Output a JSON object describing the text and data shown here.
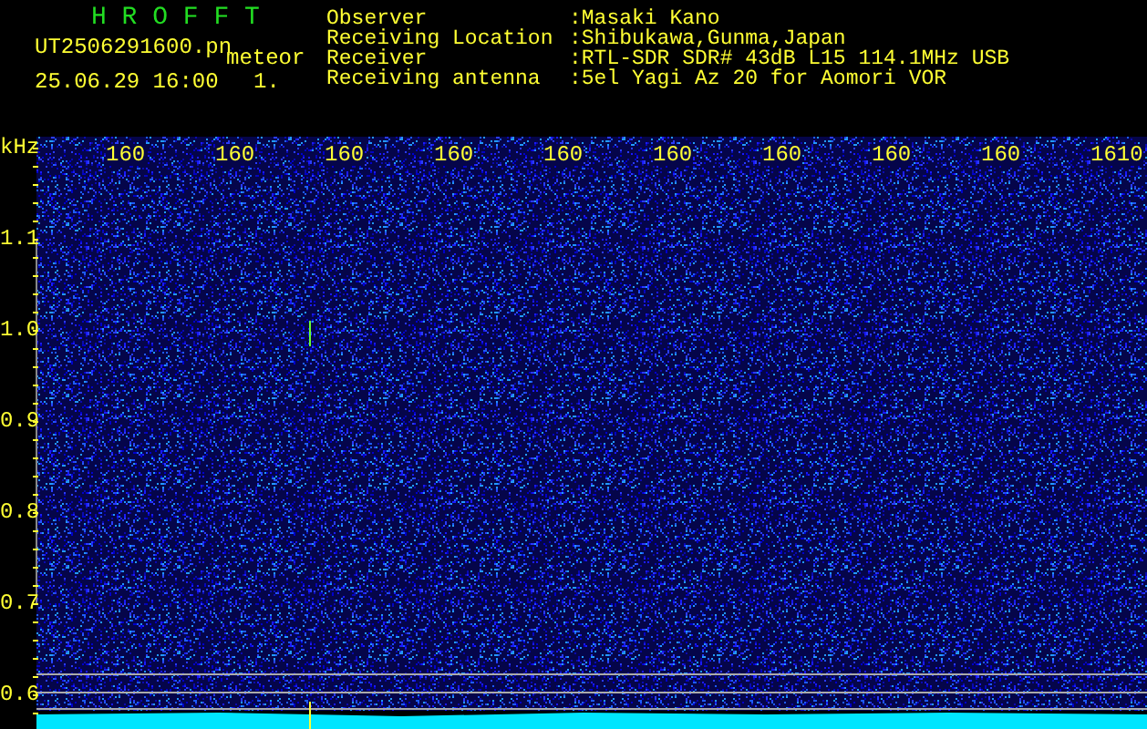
{
  "title": "H R O F F T",
  "file": {
    "name": "UT2506291600.pn",
    "tag": "meteor",
    "datetime": "25.06.29 16:00",
    "count": "1."
  },
  "info": [
    {
      "label": "Observer",
      "value": ":Masaki Kano"
    },
    {
      "label": "Receiving Location",
      "value": ":Shibukawa,Gunma,Japan"
    },
    {
      "label": "Receiver",
      "value": ":RTL-SDR SDR# 43dB L15 114.1MHz USB"
    },
    {
      "label": "Receiving antenna",
      "value": ":5el Yagi Az 20 for Aomori VOR"
    }
  ],
  "spectrogram": {
    "y_unit": "kHz",
    "time_labels": [
      "160",
      "160",
      "160",
      "160",
      "160",
      "160",
      "160",
      "160",
      "160",
      "1610"
    ],
    "freq_labels": [
      "1.1",
      "1.0",
      "0.9",
      "0.8",
      "0.7",
      "0.6"
    ]
  }
}
